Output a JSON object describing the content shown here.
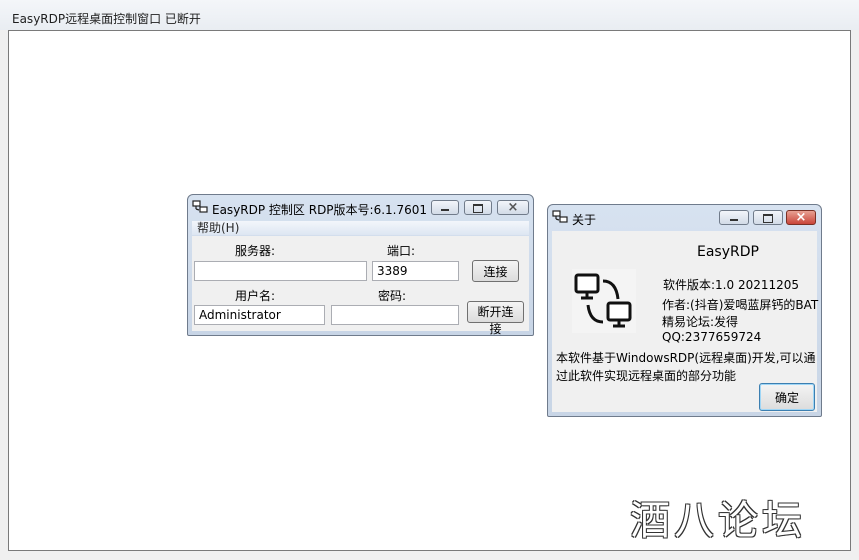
{
  "main_window": {
    "title": "EasyRDP远程桌面控制窗口 已断开"
  },
  "control_window": {
    "title": "EasyRDP 控制区 RDP版本号:6.1.7601",
    "menu": {
      "help": "帮助(H)"
    },
    "server_label": "服务器:",
    "server_value": "",
    "port_label": "端口:",
    "port_value": "3389",
    "connect_button": "连接",
    "username_label": "用户名:",
    "username_value": "Administrator",
    "password_label": "密码:",
    "password_value": "",
    "disconnect_button": "断开连接"
  },
  "about_window": {
    "title": "关于",
    "app_name": "EasyRDP",
    "version": "软件版本:1.0 20211205",
    "author": "作者:(抖音)爱喝蓝屏钙的BAT",
    "forum": "精易论坛:发得",
    "qq": "QQ:2377659724",
    "description": "本软件基于WindowsRDP(远程桌面)开发,可以通过此软件实现远程桌面的部分功能",
    "ok_button": "确定"
  },
  "watermark": "酒八论坛",
  "icons": {
    "app": "remote-desktop-icon",
    "minimize": "minimize-icon",
    "maximize": "maximize-icon",
    "close": "close-icon"
  }
}
